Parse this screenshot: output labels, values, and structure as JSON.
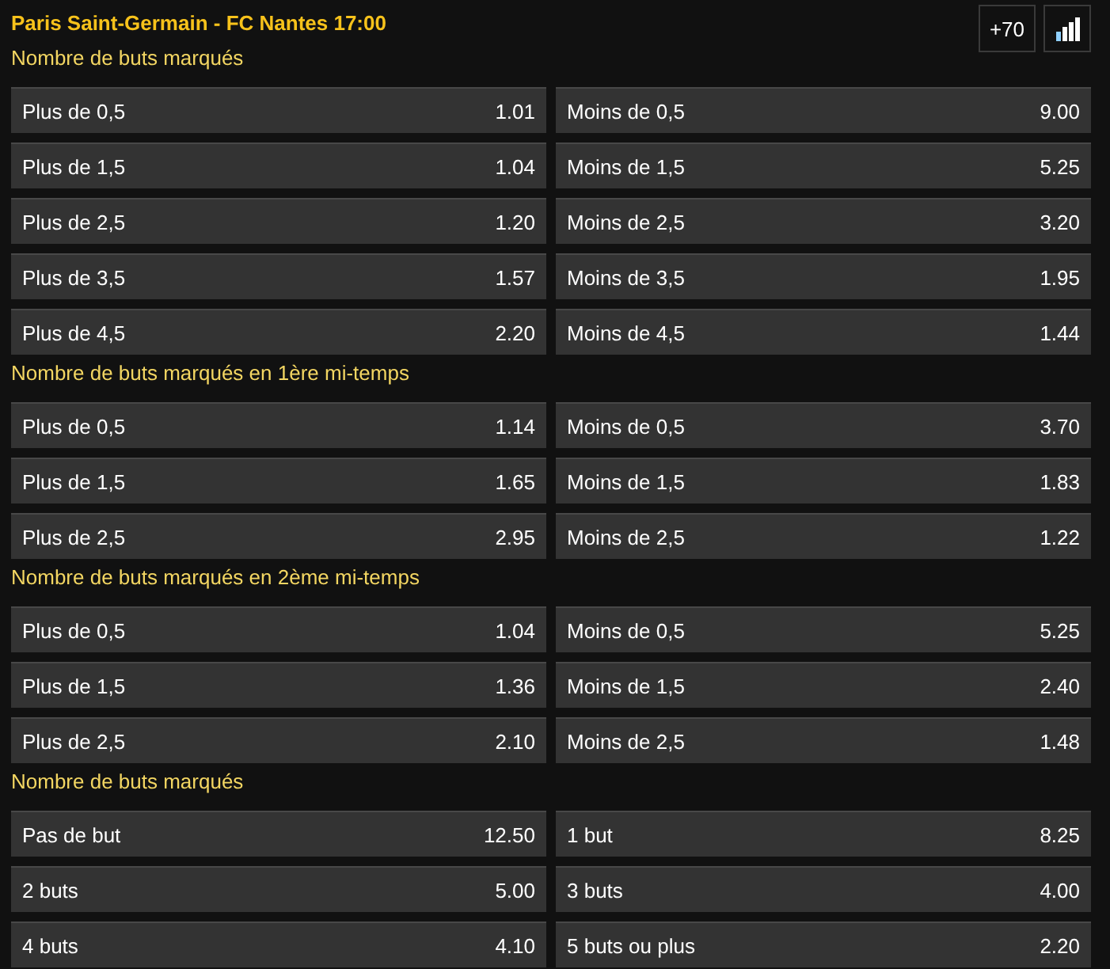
{
  "header": {
    "title": "Paris Saint-Germain - FC Nantes 17:00",
    "more_button": "+70"
  },
  "markets": [
    {
      "title": "Nombre de buts marqués",
      "outcomes": [
        {
          "label": "Plus de 0,5",
          "odds": "1.01"
        },
        {
          "label": "Moins de 0,5",
          "odds": "9.00"
        },
        {
          "label": "Plus de 1,5",
          "odds": "1.04"
        },
        {
          "label": "Moins de 1,5",
          "odds": "5.25"
        },
        {
          "label": "Plus de 2,5",
          "odds": "1.20"
        },
        {
          "label": "Moins de 2,5",
          "odds": "3.20"
        },
        {
          "label": "Plus de 3,5",
          "odds": "1.57"
        },
        {
          "label": "Moins de 3,5",
          "odds": "1.95"
        },
        {
          "label": "Plus de 4,5",
          "odds": "2.20"
        },
        {
          "label": "Moins de 4,5",
          "odds": "1.44"
        }
      ]
    },
    {
      "title": "Nombre de buts marqués en 1ère mi-temps",
      "outcomes": [
        {
          "label": "Plus de 0,5",
          "odds": "1.14"
        },
        {
          "label": "Moins de 0,5",
          "odds": "3.70"
        },
        {
          "label": "Plus de 1,5",
          "odds": "1.65"
        },
        {
          "label": "Moins de 1,5",
          "odds": "1.83"
        },
        {
          "label": "Plus de 2,5",
          "odds": "2.95"
        },
        {
          "label": "Moins de 2,5",
          "odds": "1.22"
        }
      ]
    },
    {
      "title": "Nombre de buts marqués en 2ème mi-temps",
      "outcomes": [
        {
          "label": "Plus de 0,5",
          "odds": "1.04"
        },
        {
          "label": "Moins de 0,5",
          "odds": "5.25"
        },
        {
          "label": "Plus de 1,5",
          "odds": "1.36"
        },
        {
          "label": "Moins de 1,5",
          "odds": "2.40"
        },
        {
          "label": "Plus de 2,5",
          "odds": "2.10"
        },
        {
          "label": "Moins de 2,5",
          "odds": "1.48"
        }
      ]
    },
    {
      "title": "Nombre de buts marqués",
      "outcomes": [
        {
          "label": "Pas de but",
          "odds": "12.50"
        },
        {
          "label": "1 but",
          "odds": "8.25"
        },
        {
          "label": "2 buts",
          "odds": "5.00"
        },
        {
          "label": "3 buts",
          "odds": "4.00"
        },
        {
          "label": "4 buts",
          "odds": "4.10"
        },
        {
          "label": "5 buts ou plus",
          "odds": "2.20"
        }
      ]
    }
  ]
}
